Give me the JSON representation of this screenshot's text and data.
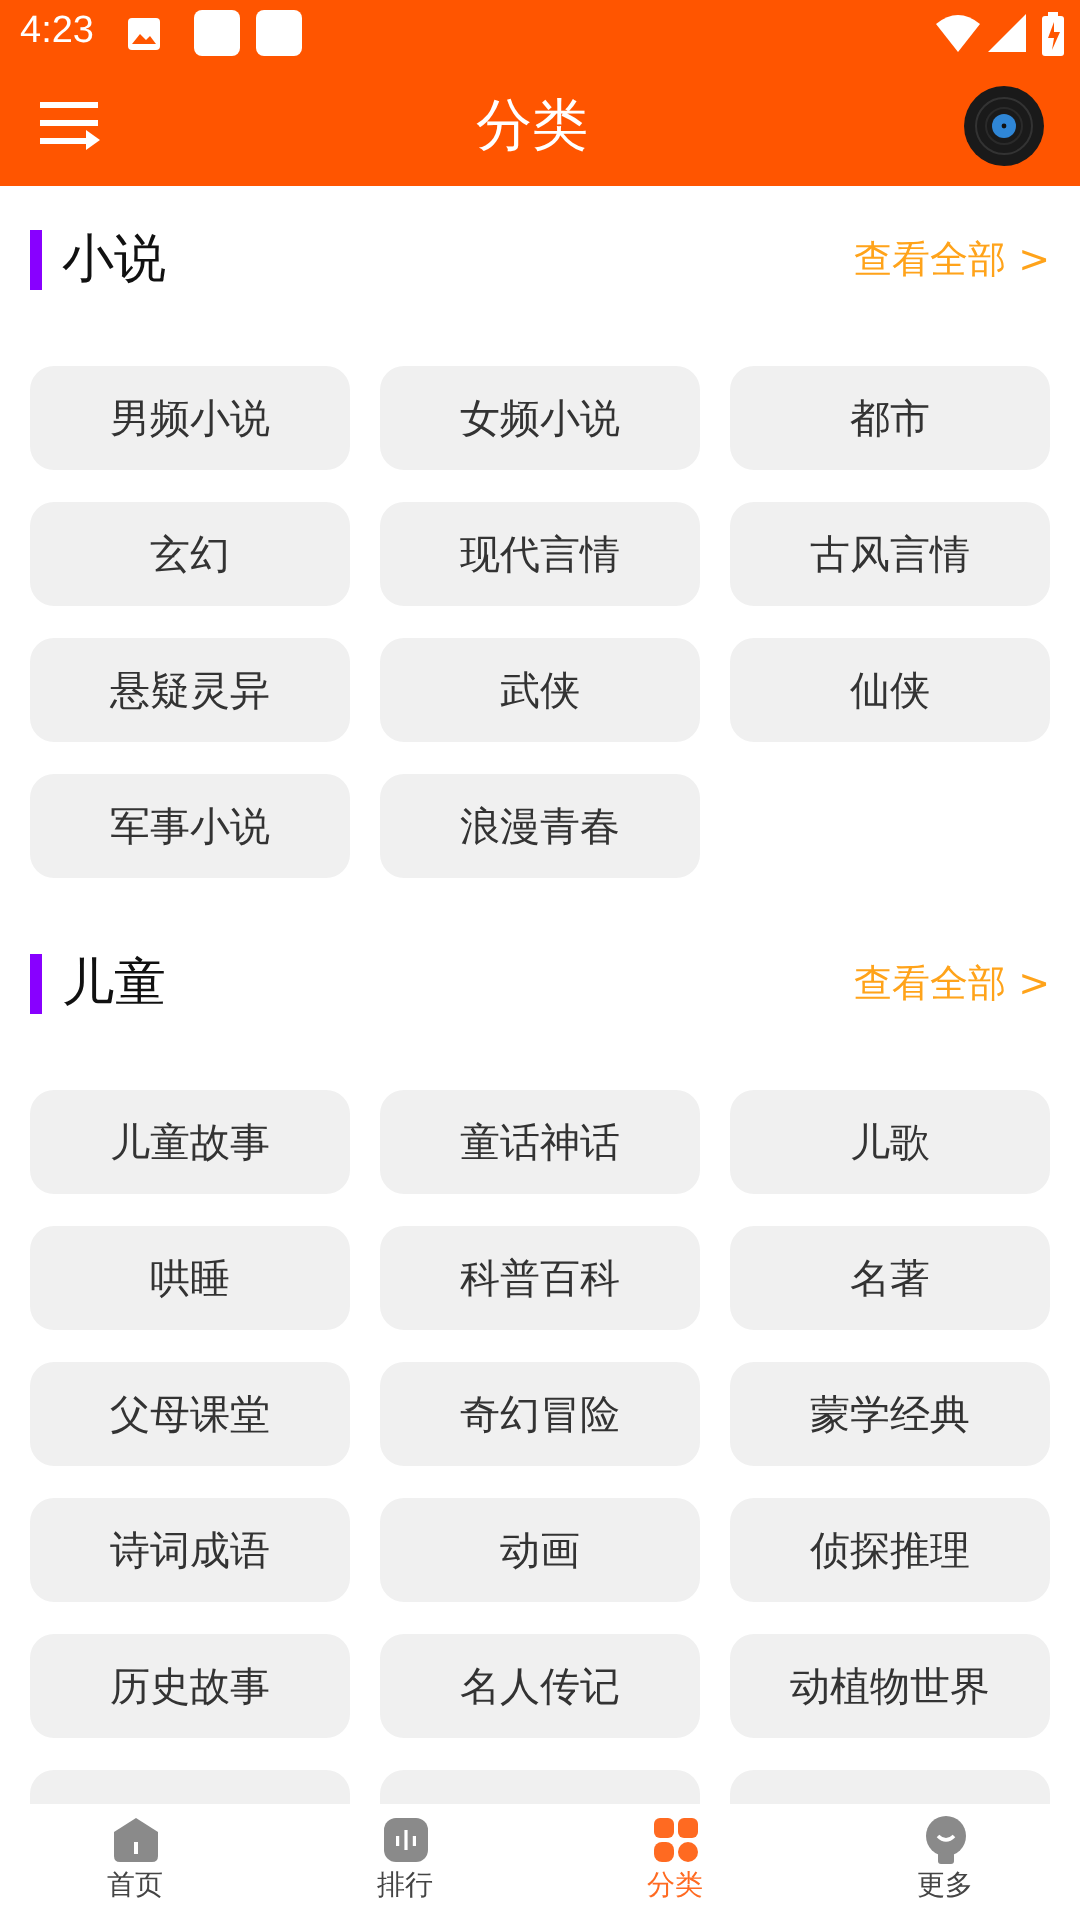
{
  "status_bar": {
    "time": "4:23"
  },
  "header": {
    "title": "分类"
  },
  "sections": [
    {
      "title": "小说",
      "more": "查看全部 >",
      "items": [
        {
          "label": "男频小说"
        },
        {
          "label": "女频小说"
        },
        {
          "label": "都市"
        },
        {
          "label": "玄幻"
        },
        {
          "label": "现代言情"
        },
        {
          "label": "古风言情"
        },
        {
          "label": "悬疑灵异"
        },
        {
          "label": "武侠"
        },
        {
          "label": "仙侠"
        },
        {
          "label": "军事小说"
        },
        {
          "label": "浪漫青春"
        }
      ]
    },
    {
      "title": "儿童",
      "more": "查看全部 >",
      "items": [
        {
          "label": "儿童故事"
        },
        {
          "label": "童话神话"
        },
        {
          "label": "儿歌"
        },
        {
          "label": "哄睡"
        },
        {
          "label": "科普百科"
        },
        {
          "label": "名著"
        },
        {
          "label": "父母课堂"
        },
        {
          "label": "奇幻冒险"
        },
        {
          "label": "蒙学经典"
        },
        {
          "label": "诗词成语"
        },
        {
          "label": "动画"
        },
        {
          "label": "侦探推理"
        },
        {
          "label": "历史故事"
        },
        {
          "label": "名人传记"
        },
        {
          "label": "动植物世界"
        },
        {
          "kind": "cut"
        },
        {
          "kind": "cut"
        },
        {
          "kind": "cut"
        }
      ]
    }
  ],
  "tabs": [
    {
      "label": "首页",
      "kind": "home",
      "selected": false
    },
    {
      "label": "排行",
      "kind": "rank",
      "selected": false
    },
    {
      "label": "分类",
      "kind": "category",
      "selected": true
    },
    {
      "label": "更多",
      "kind": "more",
      "selected": false
    }
  ]
}
